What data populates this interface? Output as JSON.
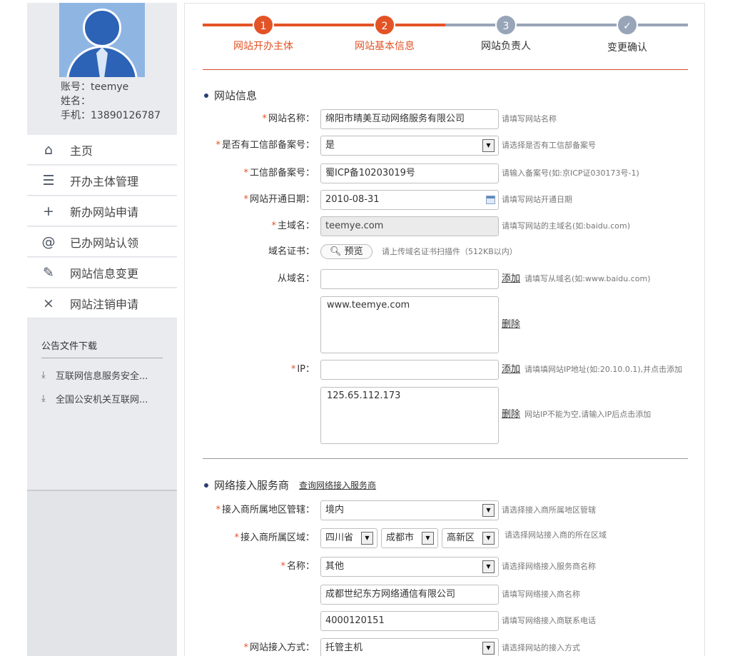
{
  "profile": {
    "account": "账号：teemye",
    "name": "姓名：",
    "phone": "手机：13890126787"
  },
  "nav": {
    "items": [
      {
        "icon": "home-icon",
        "glyph": "⌂",
        "label": "主页"
      },
      {
        "icon": "list-icon",
        "glyph": "☰",
        "label": "开办主体管理"
      },
      {
        "icon": "plus-icon",
        "glyph": "+",
        "label": "新办网站申请"
      },
      {
        "icon": "at-icon",
        "glyph": "@",
        "label": "已办网站认领"
      },
      {
        "icon": "edit-icon",
        "glyph": "✎",
        "label": "网站信息变更"
      },
      {
        "icon": "close-icon",
        "glyph": "×",
        "label": "网站注销申请"
      }
    ]
  },
  "notice": {
    "title": "公告文件下载",
    "items": [
      "互联网信息服务安全...",
      "全国公安机关互联网..."
    ]
  },
  "steps": [
    {
      "num": "1",
      "label": "网站开办主体",
      "state": "active"
    },
    {
      "num": "2",
      "label": "网站基本信息",
      "state": "active"
    },
    {
      "num": "3",
      "label": "网站负责人",
      "state": "todo"
    },
    {
      "num": "✓",
      "label": "变更确认",
      "state": "todo"
    }
  ],
  "colors": {
    "accent": "#e35326",
    "inactive": "#98a5b8",
    "dot": "#2c3f73"
  },
  "site_info": {
    "section_title": "网站信息",
    "site_name": {
      "label": "网站名称：",
      "value": "绵阳市晴美互动网络服务有限公司",
      "hint": "请填写网站名称"
    },
    "has_record": {
      "label": "是否有工信部备案号：",
      "value": "是",
      "hint": "请选择是否有工信部备案号"
    },
    "record_no": {
      "label": "工信部备案号：",
      "value": "蜀ICP备10203019号",
      "hint": "请输入备案号(如:京ICP证030173号-1)"
    },
    "open_date": {
      "label": "网站开通日期：",
      "value": "2010-08-31",
      "hint": "请填写网站开通日期"
    },
    "main_domain": {
      "label": "主域名：",
      "value": "teemye.com",
      "hint": "请填写网站的主域名(如:baidu.com)"
    },
    "domain_cert": {
      "label": "域名证书：",
      "button": "预览",
      "hint": "请上传域名证书扫描件（512KB以内）"
    },
    "sub_domain": {
      "label": "从域名：",
      "value": "",
      "add": "添加",
      "hint": "请填写从域名(如:www.baidu.com)",
      "list": "www.teemye.com",
      "delete": "删除"
    },
    "ip": {
      "label": "IP：",
      "value": "",
      "add": "添加",
      "hint": "请填填网站IP地址(如:20.10.0.1),并点击添加",
      "list": "125.65.112.173",
      "delete": "删除",
      "delete_hint": "网站IP不能为空,请输入IP后点击添加"
    }
  },
  "isp": {
    "section_title": "网络接入服务商",
    "query_link": "查询网络接入服务商",
    "region_jurisdiction": {
      "label": "接入商所属地区管辖：",
      "value": "境内",
      "hint": "请选择接入商所属地区管辖"
    },
    "region": {
      "label": "接入商所属区域：",
      "province": "四川省",
      "city": "成都市",
      "district": "高新区",
      "hint": "请选择网站接入商的所在区域"
    },
    "name": {
      "label": "名称：",
      "value": "其他",
      "hint": "请选择网络接入服务商名称"
    },
    "company": {
      "value": "成都世纪东方网络通信有限公司",
      "hint": "请填写网络接入商名称"
    },
    "phone": {
      "value": "4000120151",
      "hint": "请填写网络接入商联系电话"
    },
    "access_mode": {
      "label": "网站接入方式：",
      "value": "托管主机",
      "hint": "请选择网站的接入方式"
    }
  }
}
